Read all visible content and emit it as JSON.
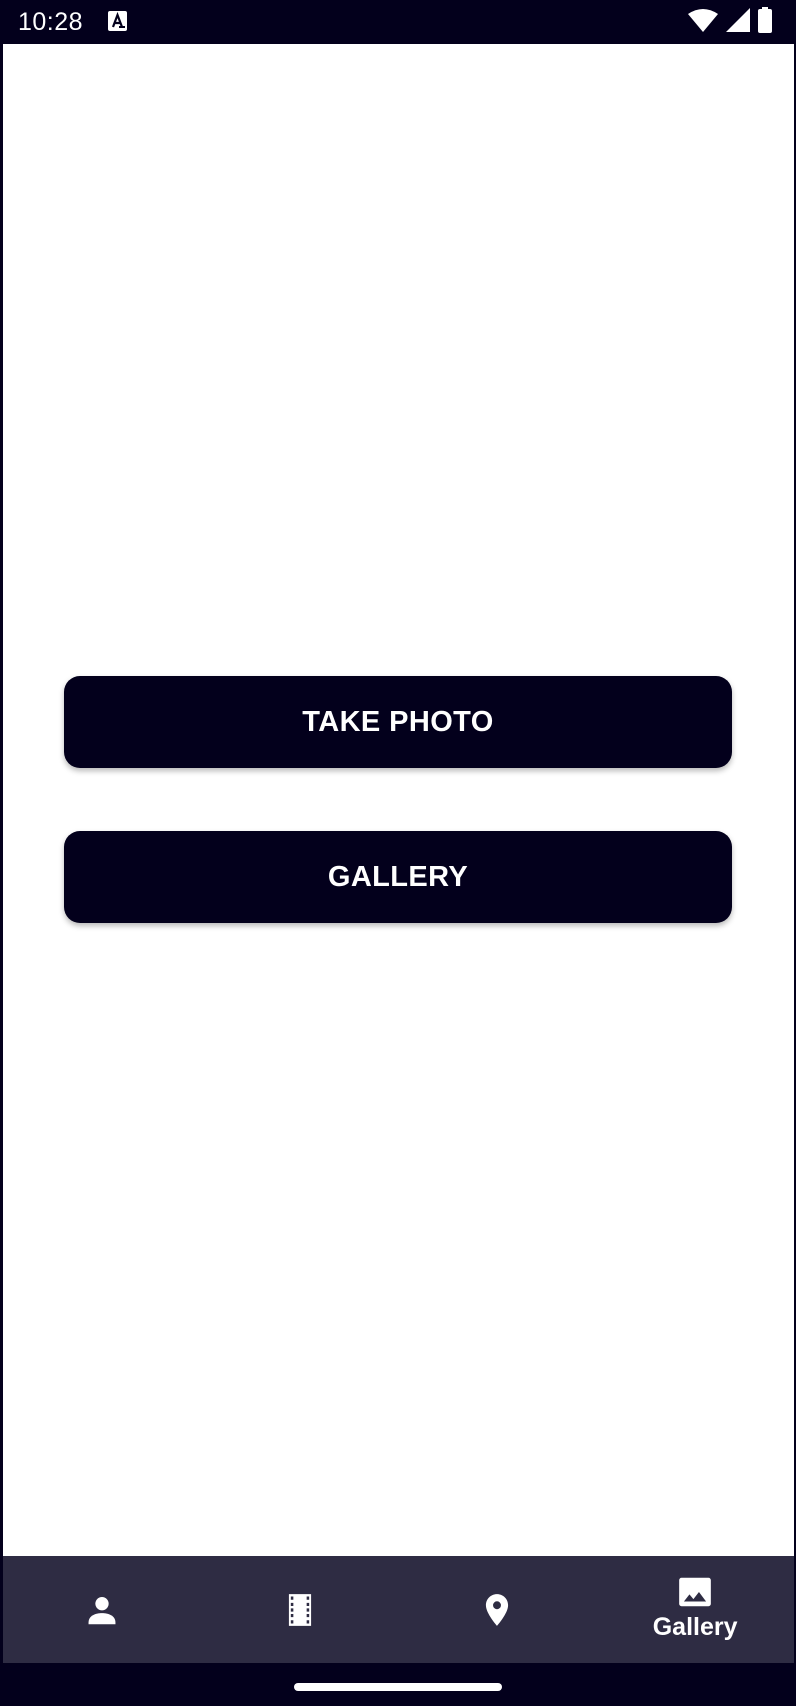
{
  "status_bar": {
    "time": "10:28",
    "icons": [
      "notification-a-icon",
      "wifi-icon",
      "cellular-signal-icon",
      "battery-icon"
    ]
  },
  "main": {
    "take_photo_label": "TAKE PHOTO",
    "gallery_label": "GALLERY"
  },
  "bottom_nav": {
    "items": [
      {
        "icon": "person-icon",
        "label": ""
      },
      {
        "icon": "film-icon",
        "label": ""
      },
      {
        "icon": "location-pin-icon",
        "label": ""
      },
      {
        "icon": "image-icon",
        "label": "Gallery",
        "active": true
      }
    ]
  },
  "colors": {
    "primary": "#03001c",
    "nav_background": "#2e2c43",
    "content_background": "#ffffff",
    "on_primary": "#ffffff"
  }
}
